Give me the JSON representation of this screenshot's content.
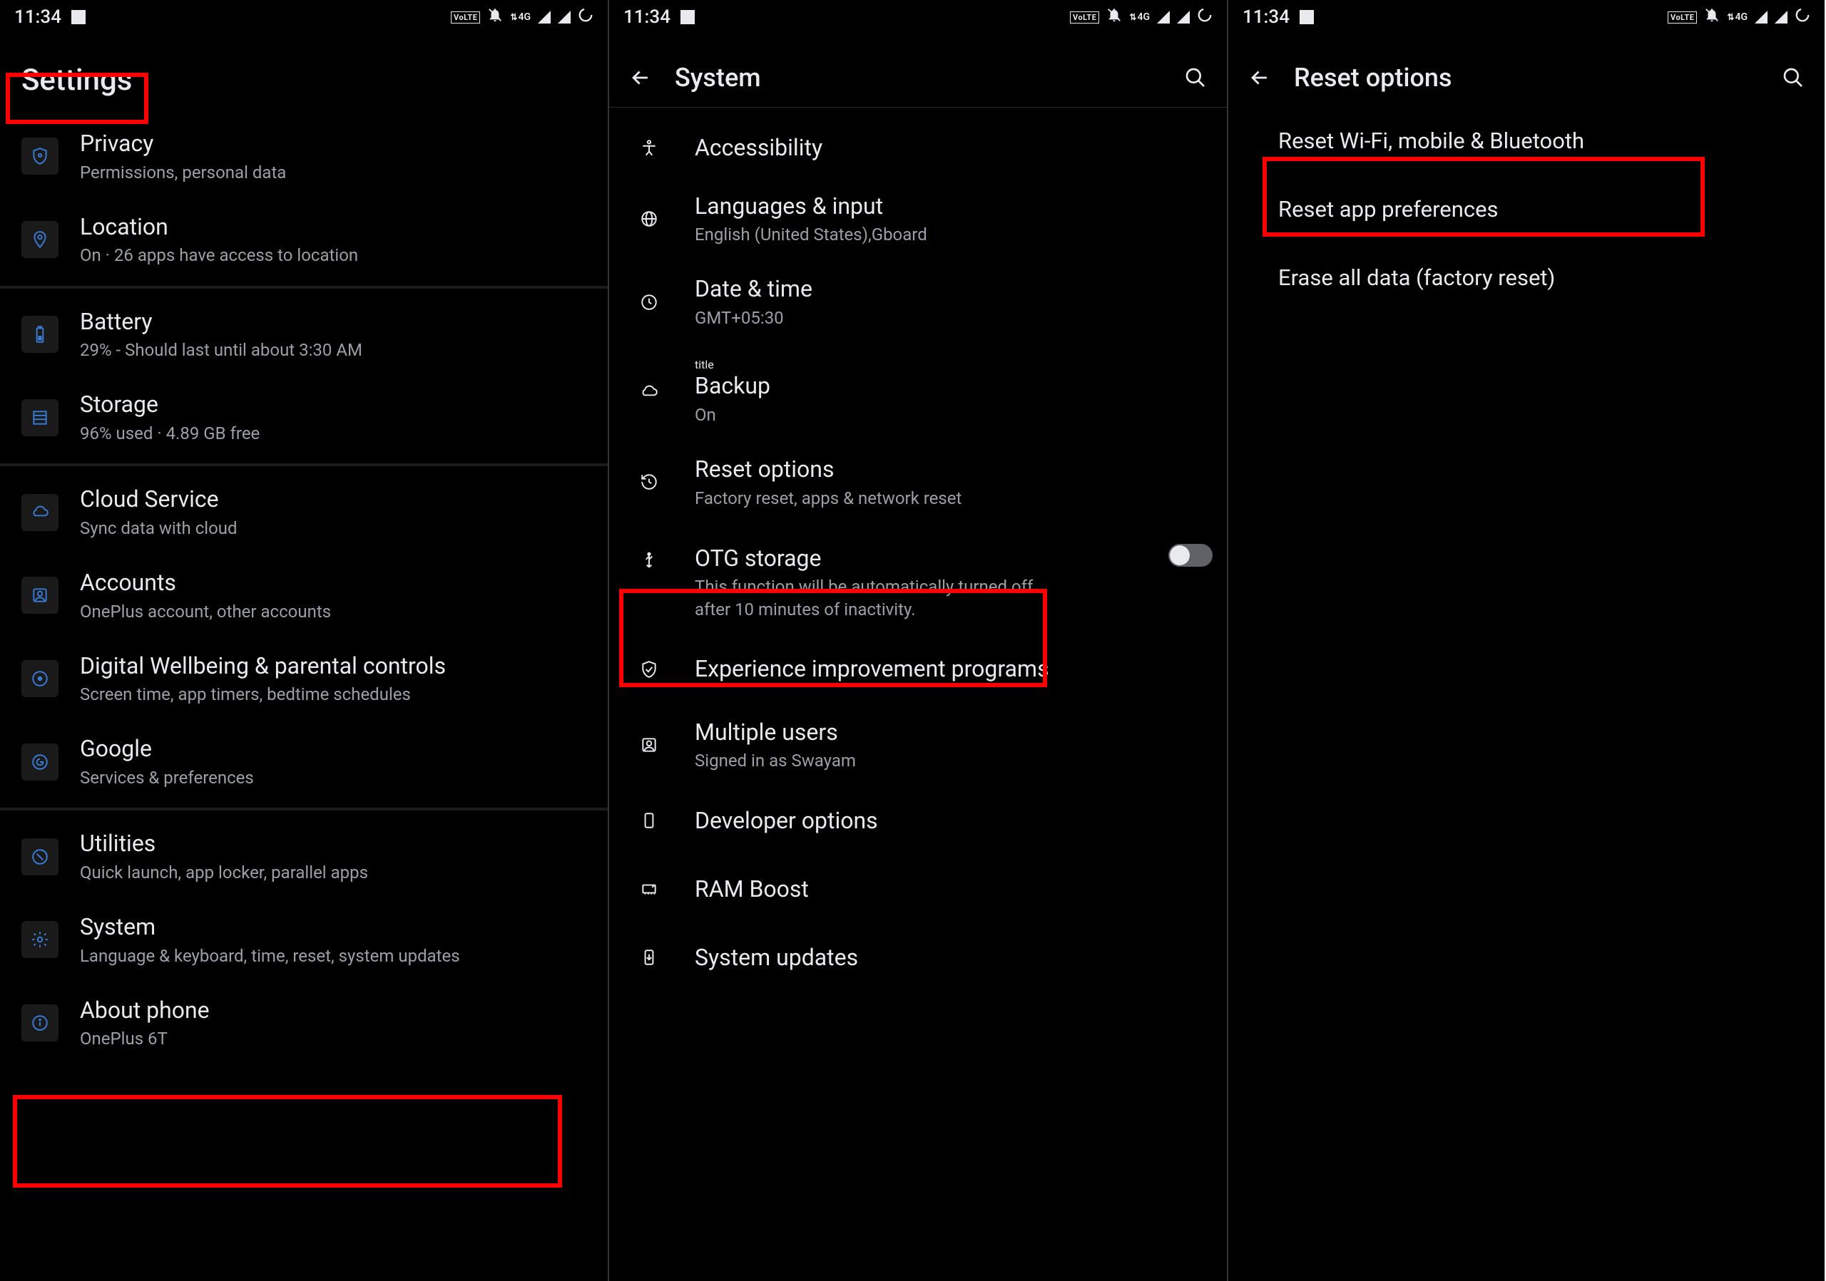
{
  "status": {
    "time": "11:34",
    "volte": "VoLTE",
    "net": "4G"
  },
  "screen1": {
    "title": "Settings",
    "items": [
      {
        "icon": "shield",
        "title": "Privacy",
        "sub": "Permissions, personal data"
      },
      {
        "icon": "pin",
        "title": "Location",
        "sub": "On · 26 apps have access to location"
      },
      {
        "icon": "battery",
        "title": "Battery",
        "sub": "29% - Should last until about 3:30 AM"
      },
      {
        "icon": "storage",
        "title": "Storage",
        "sub": "96% used · 4.89 GB free"
      },
      {
        "icon": "cloud",
        "title": "Cloud Service",
        "sub": "Sync data with cloud"
      },
      {
        "icon": "account",
        "title": "Accounts",
        "sub": "OnePlus account, other accounts"
      },
      {
        "icon": "wellbeing",
        "title": "Digital Wellbeing & parental controls",
        "sub": "Screen time, app timers, bedtime schedules"
      },
      {
        "icon": "google",
        "title": "Google",
        "sub": "Services & preferences"
      },
      {
        "icon": "utilities",
        "title": "Utilities",
        "sub": "Quick launch, app locker, parallel apps"
      },
      {
        "icon": "gear",
        "title": "System",
        "sub": "Language & keyboard, time, reset, system updates"
      },
      {
        "icon": "info",
        "title": "About phone",
        "sub": "OnePlus 6T"
      }
    ]
  },
  "screen2": {
    "title": "System",
    "items": [
      {
        "icon": "accessibility",
        "title": "Accessibility",
        "sub": ""
      },
      {
        "icon": "globe",
        "title": "Languages & input",
        "sub": "English (United States),Gboard"
      },
      {
        "icon": "clock",
        "title": "Date & time",
        "sub": "GMT+05:30"
      },
      {
        "icon": "cloud",
        "title": "Backup",
        "sub": "On"
      },
      {
        "icon": "history",
        "title": "Reset options",
        "sub": "Factory reset, apps & network reset"
      },
      {
        "icon": "usb",
        "title": "OTG storage",
        "sub": "This function will be automatically turned off after 10 minutes of inactivity.",
        "toggle": true
      },
      {
        "icon": "shield-check",
        "title": "Experience improvement programs",
        "sub": ""
      },
      {
        "icon": "users",
        "title": "Multiple users",
        "sub": "Signed in as  Swayam"
      },
      {
        "icon": "phone-dev",
        "title": "Developer options",
        "sub": ""
      },
      {
        "icon": "ram",
        "title": "RAM Boost",
        "sub": ""
      },
      {
        "icon": "download",
        "title": "System updates",
        "sub": ""
      }
    ]
  },
  "screen3": {
    "title": "Reset options",
    "items": [
      {
        "title": "Reset Wi-Fi, mobile & Bluetooth"
      },
      {
        "title": "Reset app preferences"
      },
      {
        "title": "Erase all data (factory reset)"
      }
    ]
  }
}
